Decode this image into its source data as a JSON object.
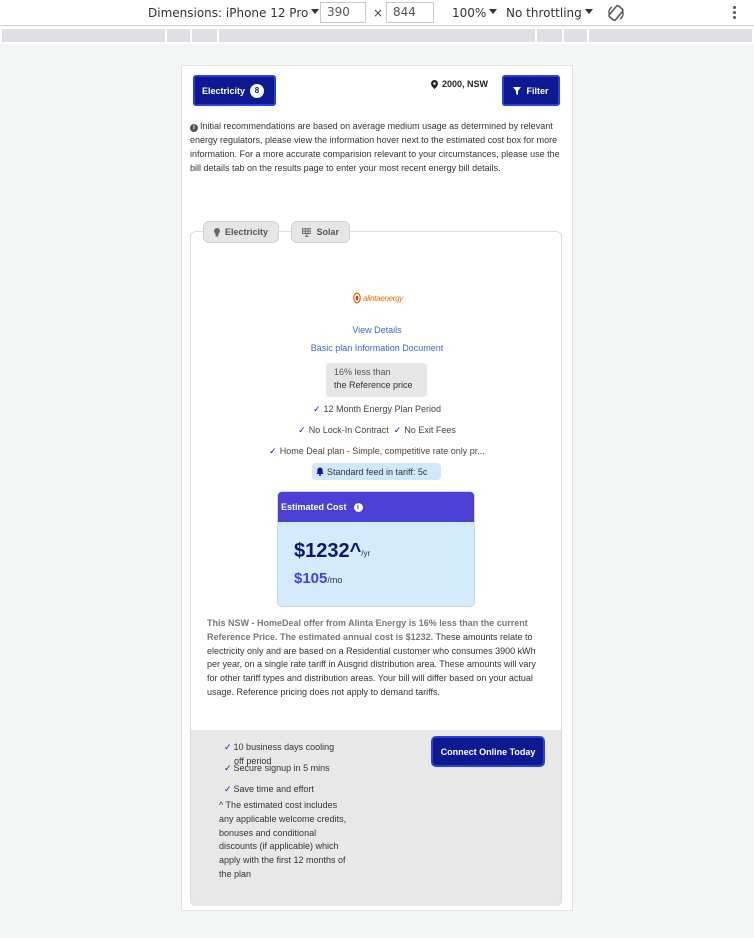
{
  "devtools": {
    "dimensions_label": "Dimensions: iPhone 12 Pro",
    "width": "390",
    "times": "×",
    "height": "844",
    "zoom": "100%",
    "throttling": "No throttling"
  },
  "header": {
    "electricity_label": "Electricity",
    "electricity_count": "8",
    "location": "2000, NSW",
    "filter_label": "Filter"
  },
  "intro": "Initial recommendations are based on average medium usage as determined by relevant energy regulators, please view the information hover next to the estimated cost box for more information. For a more accurate comparision relevant to your circumstances, please use the bill details tab on the results page to enter your most recent energy bill details.",
  "tabs": [
    {
      "label": "Electricity",
      "icon": "lightbulb-icon"
    },
    {
      "label": "Solar",
      "icon": "solar-panel-icon"
    }
  ],
  "plan": {
    "retailer_logo_text": "alintaenergy",
    "view_details": "View Details",
    "basic_plan_doc": "Basic plan Information Document",
    "ref_line1": "16% less than",
    "ref_line2": "the Reference price",
    "feature_period": "12 Month Energy Plan Period",
    "feature_lockin": "No Lock-In Contract",
    "feature_exit": "No Exit Fees",
    "feature_home_deal": "Home Deal plan - Simple, competitive rate only pr...",
    "feed_in": "Standard feed in tariff: 5c"
  },
  "estimate": {
    "title": "Estimated Cost",
    "yearly": "$1232^",
    "yearly_unit": "/yr",
    "monthly": "$105",
    "monthly_unit": "/mo"
  },
  "description": {
    "bold": "This NSW - HomeDeal offer from Alinta Energy is 16% less than the current Reference Price. The estimated annual cost is $1232.",
    "rest": " These amounts relate to electricity only and are based on a Residential customer who consumes 3900 kWh per year, on a single rate tariff in Ausgrid distribution area. These amounts will vary for other tariff types and distribution areas. Your bill will differ based on your actual usage. Reference pricing does not apply to demand tariffs."
  },
  "footer": {
    "item1": "10 business days cooling off period",
    "item2": "Secure signup in 5 mins",
    "item3": "Save time and effort",
    "note": "^ The estimated cost includes any applicable welcome credits, bonuses and conditional discounts (if applicable) which apply with the first 12 months of the plan",
    "connect_label": "Connect Online Today"
  },
  "colors": {
    "primary": "#0d1891",
    "accent": "#4c3fd5",
    "estimate_bg": "#d4ebfb",
    "link": "#3b63c9"
  }
}
